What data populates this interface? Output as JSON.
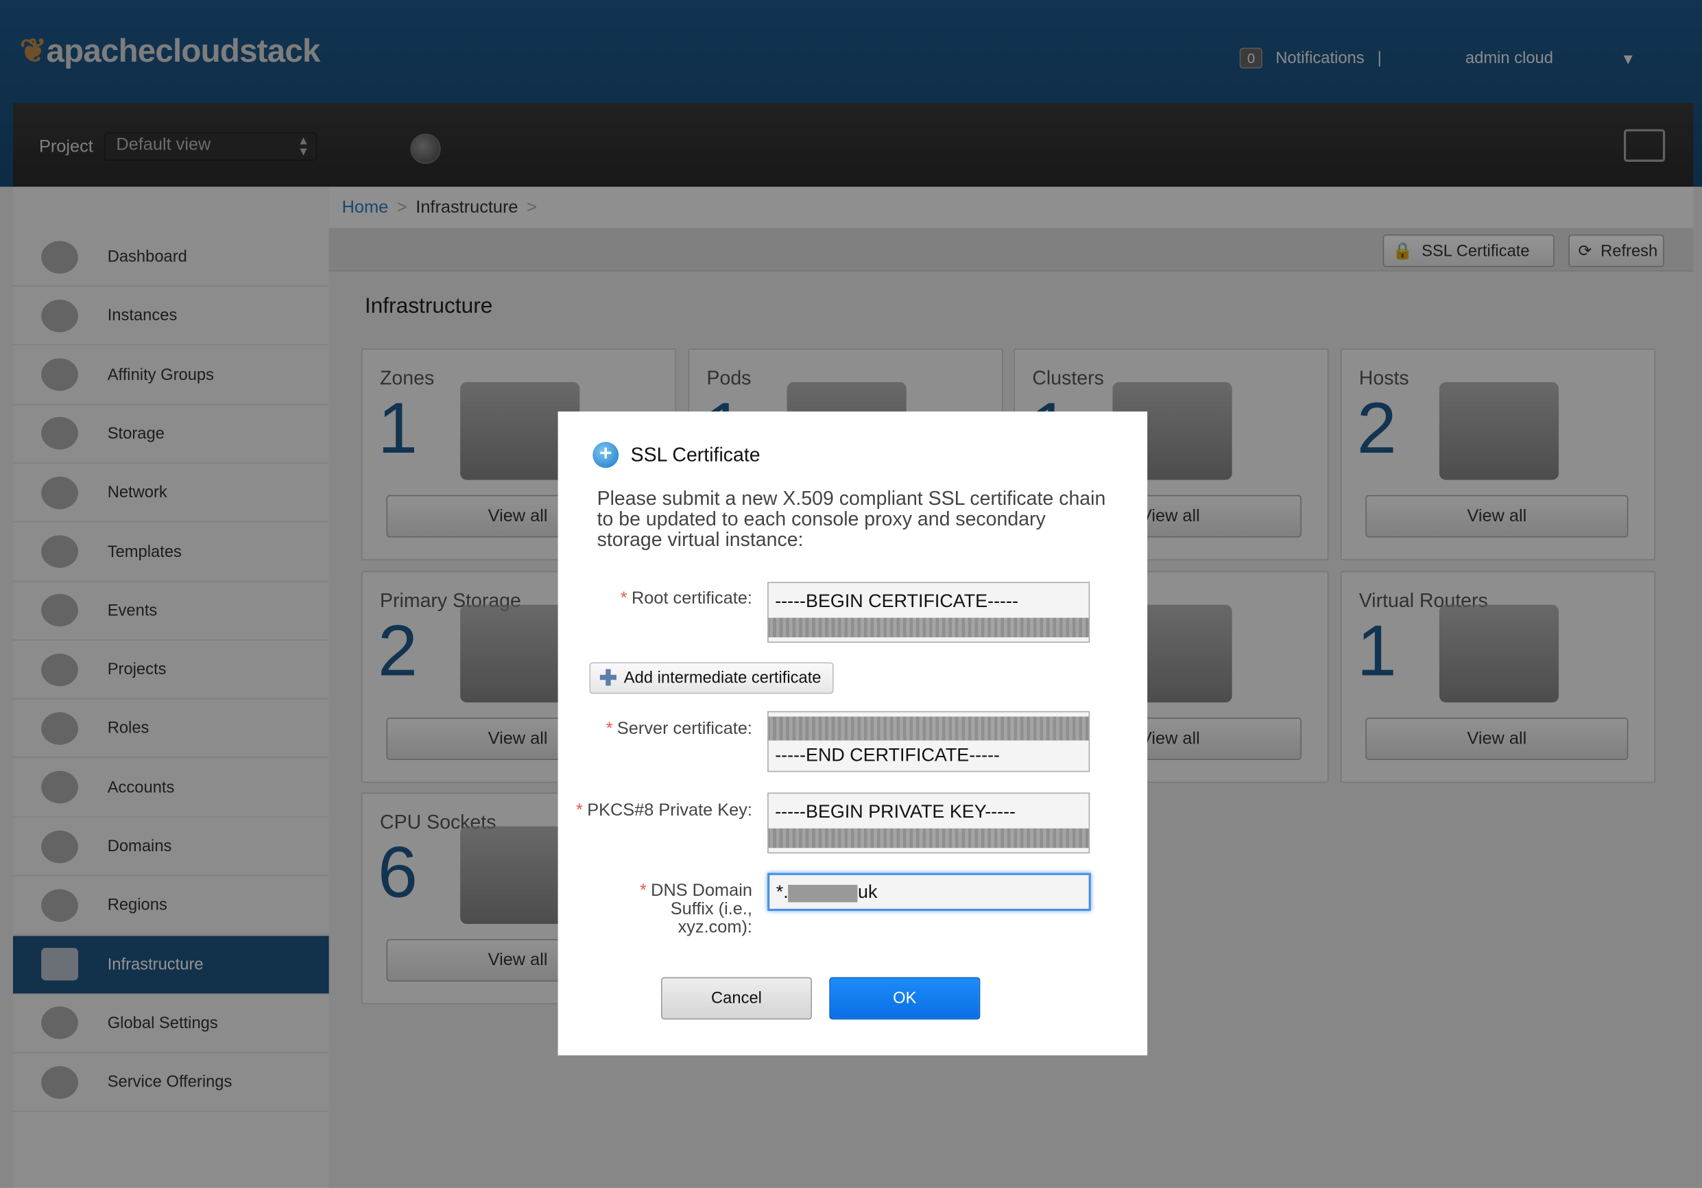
{
  "header": {
    "logo": "apachecloudstack",
    "notifications_count": "0",
    "notifications_label": "Notifications",
    "separator": "|",
    "user": "admin cloud"
  },
  "navbar": {
    "project_label": "Project",
    "project_value": "Default view"
  },
  "sidebar": {
    "items": [
      {
        "label": "Dashboard",
        "icon": "dashboard-icon"
      },
      {
        "label": "Instances",
        "icon": "cloud-icon"
      },
      {
        "label": "Affinity Groups",
        "icon": "affinity-icon"
      },
      {
        "label": "Storage",
        "icon": "storage-icon"
      },
      {
        "label": "Network",
        "icon": "network-icon"
      },
      {
        "label": "Templates",
        "icon": "templates-icon"
      },
      {
        "label": "Events",
        "icon": "calendar-icon"
      },
      {
        "label": "Projects",
        "icon": "folder-icon"
      },
      {
        "label": "Roles",
        "icon": "roles-icon"
      },
      {
        "label": "Accounts",
        "icon": "user-icon"
      },
      {
        "label": "Domains",
        "icon": "domains-icon"
      },
      {
        "label": "Regions",
        "icon": "globe-icon"
      },
      {
        "label": "Infrastructure",
        "icon": "infrastructure-icon",
        "active": true
      },
      {
        "label": "Global Settings",
        "icon": "globe-settings-icon"
      },
      {
        "label": "Service Offerings",
        "icon": "gear-icon"
      }
    ]
  },
  "breadcrumb": {
    "home": "Home",
    "current": "Infrastructure",
    "sep": ">"
  },
  "toolbar": {
    "ssl": "SSL Certificate",
    "refresh": "Refresh"
  },
  "main": {
    "title": "Infrastructure",
    "view_all": "View all",
    "cards": [
      {
        "title": "Zones",
        "count": "1"
      },
      {
        "title": "Pods",
        "count": "1"
      },
      {
        "title": "Clusters",
        "count": "1"
      },
      {
        "title": "Hosts",
        "count": "2"
      },
      {
        "title": "Primary Storage",
        "count": "2"
      },
      {
        "title": "",
        "count": ""
      },
      {
        "title": "",
        "count": ""
      },
      {
        "title": "Virtual Routers",
        "count": "1"
      },
      {
        "title": "CPU Sockets",
        "count": "6"
      }
    ]
  },
  "dialog": {
    "title": "SSL Certificate",
    "description": "Please submit a new X.509 compliant SSL certificate chain to be updated to each console proxy and secondary storage virtual instance:",
    "root_label": "Root certificate:",
    "root_value": "-----BEGIN CERTIFICATE-----",
    "add_intermediate": "Add intermediate certificate",
    "server_label": "Server certificate:",
    "server_value": "-----END CERTIFICATE-----",
    "key_label": "PKCS#8 Private Key:",
    "key_value": "-----BEGIN PRIVATE KEY-----",
    "dns_label": "DNS Domain Suffix (i.e., xyz.com):",
    "dns_prefix": "*.",
    "dns_suffix": "uk",
    "required": "*",
    "cancel": "Cancel",
    "ok": "OK"
  }
}
